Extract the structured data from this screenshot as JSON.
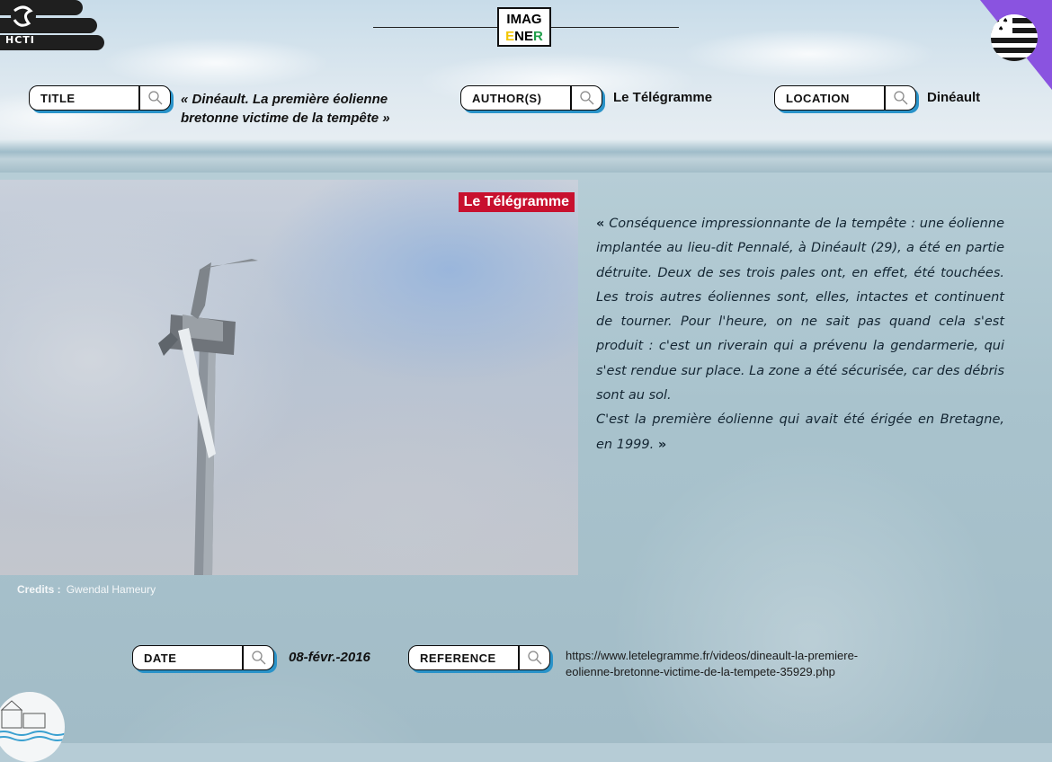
{
  "header": {
    "brand_left": "HCTI",
    "center_logo": {
      "line1": "IMAG",
      "line2_letter": "E",
      "line2_rest": "NE",
      "line2_last": "R"
    }
  },
  "fields": {
    "title": {
      "label": "TITLE",
      "value_line1": "« Dinéault. La première éolienne",
      "value_line2": "bretonne victime de la tempête »"
    },
    "author": {
      "label": "AUTHOR(S)",
      "value": "Le Télégramme"
    },
    "location": {
      "label": "LOCATION",
      "value": "Dinéault"
    },
    "date": {
      "label": "DATE",
      "value": "08-févr.-2016"
    },
    "reference": {
      "label": "REFERENCE",
      "value_line1": "https://www.letelegramme.fr/videos/dineault-la-premiere-",
      "value_line2": "eolienne-bretonne-victime-de-la-tempete-35929.php"
    }
  },
  "media": {
    "badge": "Le Télégramme",
    "credits_label": "Credits :",
    "credits_value": "Gwendal Hameury"
  },
  "quote": {
    "open": "«",
    "para1": "Conséquence impressionnante de la tempête : une éolienne implantée au lieu-dit Pennalé, à Dinéault (29), a été en partie détruite. Deux de ses trois pales ont, en effet, été touchées. Les trois autres éoliennes sont, elles, intactes et continuent de tourner. Pour l'heure, on ne sait pas quand cela s'est produit : c'est un riverain qui a prévenu la gendarmerie, qui s'est rendue sur place. La zone a été sécurisée, car des débris sont au sol.",
    "para2": "C'est la première éolienne qui avait été érigée en Bretagne, en 1999.",
    "close": "»"
  },
  "colors": {
    "accent_blue": "#2a93c9",
    "purple": "#8a53e0",
    "badge_red": "#c8102e",
    "logo_yellow": "#f2c500",
    "logo_green": "#1f9e49"
  },
  "icons": [
    "search-icon",
    "hcti-logo-icon",
    "breton-flag-icon",
    "stamp-illustration-icon"
  ]
}
